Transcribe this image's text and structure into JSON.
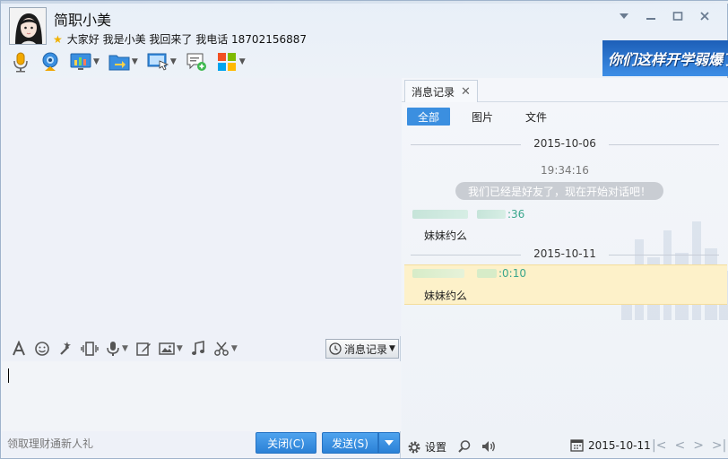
{
  "contact": {
    "name": "简职小美",
    "signature": "大家好 我是小美 我回来了   我电话 18702156887"
  },
  "banner": {
    "text": "你们这样开学弱爆了"
  },
  "input_tools": {
    "history_label": "消息记录"
  },
  "input": {
    "value": ""
  },
  "bottom": {
    "ad_text": "领取理财通新人礼",
    "close_label": "关闭(C)",
    "send_label": "发送(S)"
  },
  "history": {
    "tab_label": "消息记录",
    "filters": [
      "全部",
      "图片",
      "文件"
    ],
    "active_filter": "全部",
    "date1": "2015-10-06",
    "time1": "19:34:16",
    "system_msg": "我们已经是好友了，现在开始对话吧！",
    "msg1_time": ":36",
    "msg1_text": "妹妹约么",
    "date2": "2015-10-11",
    "msg2_time": ":0:10",
    "msg2_text": "妹妹约么",
    "settings_label": "设置",
    "current_date": "2015-10-11"
  },
  "colors": {
    "accent": "#3b8fe0",
    "highlight": "#fdf1c9",
    "time_green": "#3aa68c"
  }
}
